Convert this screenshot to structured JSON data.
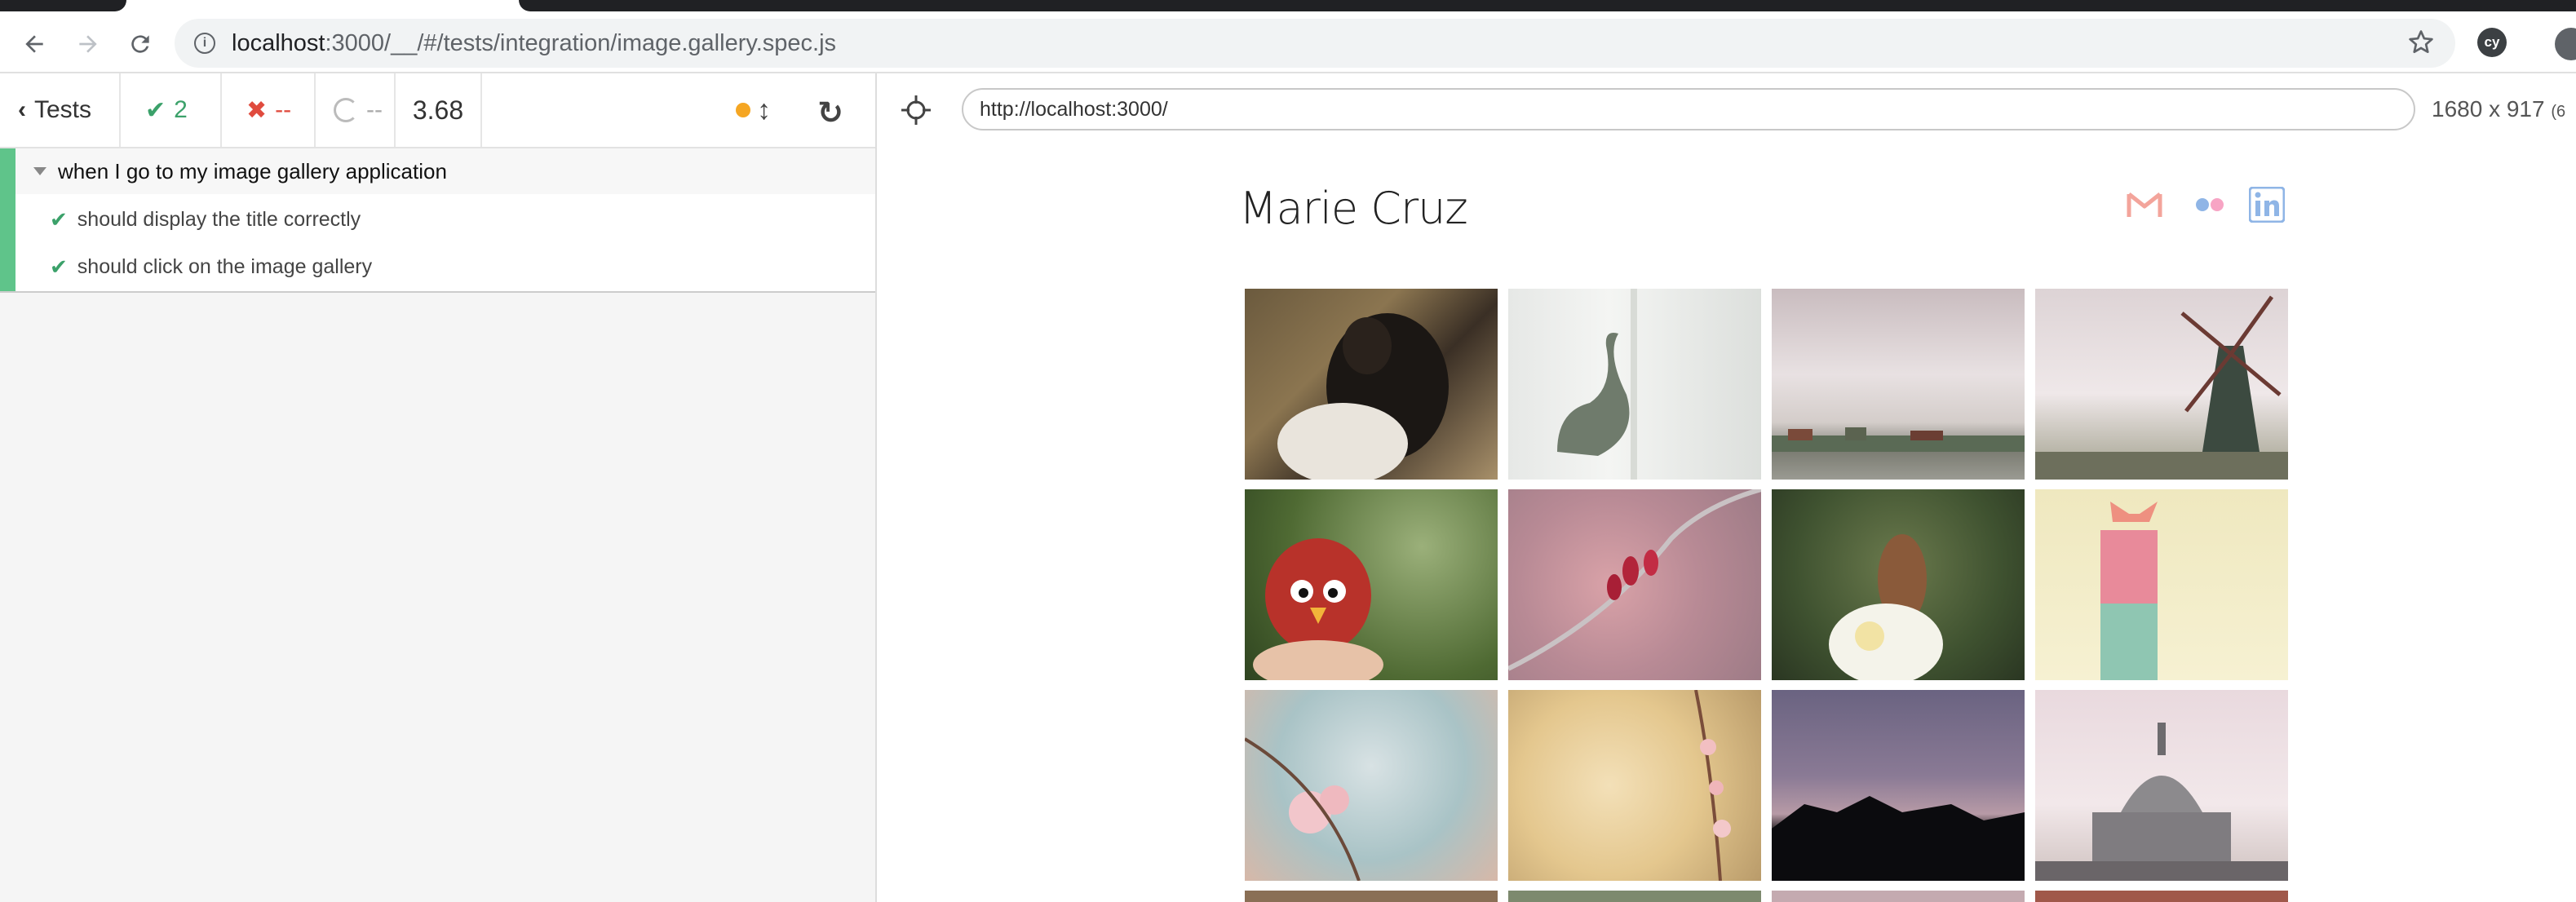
{
  "browser": {
    "url_host": "localhost",
    "url_rest": ":3000/__/#/tests/integration/image.gallery.spec.js",
    "extension_label": "cy"
  },
  "reporter": {
    "tests_label": "Tests",
    "passed_count": "2",
    "failed_count": "--",
    "pending_count": "--",
    "duration": "3.68",
    "suite_title": "when I go to my image gallery application",
    "tests": [
      {
        "title": "should display the title correctly",
        "state": "passed"
      },
      {
        "title": "should click on the image gallery",
        "state": "passed"
      }
    ]
  },
  "aut": {
    "url": "http://localhost:3000/",
    "viewport_size": "1680 x 917",
    "viewport_overflow": "(6",
    "site_title": "Marie Cruz",
    "social_icons": [
      "gmail-icon",
      "flickr-icon",
      "linkedin-icon"
    ],
    "gallery": [
      {
        "subject": "dog"
      },
      {
        "subject": "origami-swan"
      },
      {
        "subject": "village-clouds"
      },
      {
        "subject": "windmill"
      },
      {
        "subject": "origami-bird"
      },
      {
        "subject": "red-berries"
      },
      {
        "subject": "butterfly"
      },
      {
        "subject": "origami-cat"
      },
      {
        "subject": "cherry-blossom"
      },
      {
        "subject": "blossom-branch"
      },
      {
        "subject": "silhouette"
      },
      {
        "subject": "st-pauls-dome"
      }
    ]
  },
  "colors": {
    "pass": "#3ba16a",
    "fail": "#e04b3e",
    "accent": "#f5a623",
    "suite_bar": "#5fc48a"
  }
}
